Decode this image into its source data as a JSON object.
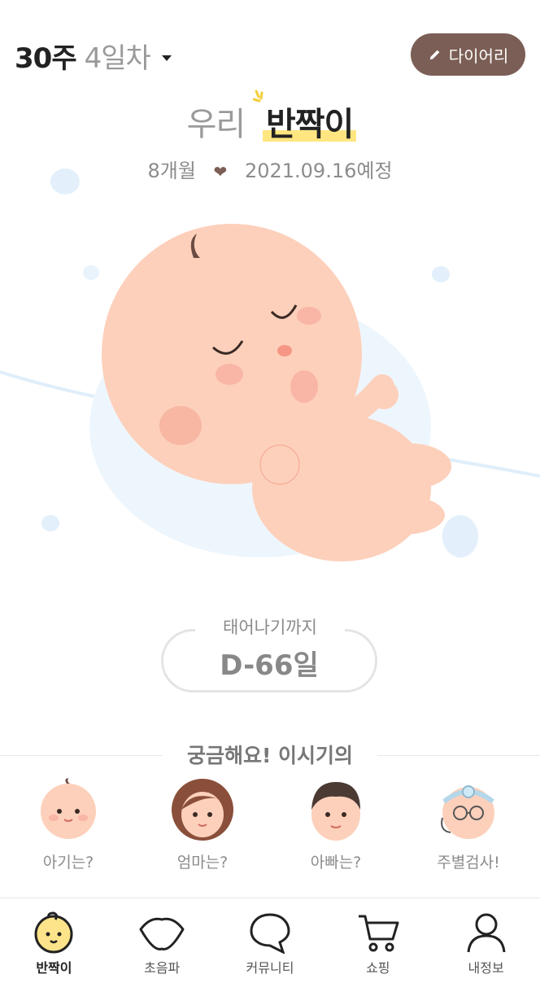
{
  "header": {
    "week": "30주",
    "day": "4일차",
    "diary_label": "다이어리"
  },
  "title": {
    "prefix": "우리",
    "name": "반짝이"
  },
  "subtitle": {
    "months": "8개월",
    "heart": "❤",
    "due": "2021.09.16예정"
  },
  "countdown": {
    "label": "태어나기까지",
    "value": "D-66일"
  },
  "curious": {
    "title": "궁금해요! 이시기의",
    "items": [
      {
        "label": "아기는?"
      },
      {
        "label": "엄마는?"
      },
      {
        "label": "아빠는?"
      },
      {
        "label": "주별검사!"
      }
    ]
  },
  "nav": {
    "items": [
      {
        "label": "반짝이",
        "icon": "baby-face-icon"
      },
      {
        "label": "초음파",
        "icon": "ultrasound-icon"
      },
      {
        "label": "커뮤니티",
        "icon": "chat-bubble-icon"
      },
      {
        "label": "쇼핑",
        "icon": "cart-icon"
      },
      {
        "label": "내정보",
        "icon": "person-icon"
      }
    ],
    "active_index": 0
  },
  "colors": {
    "brand_brown": "#7b5e55",
    "highlight_yellow": "#ffe680",
    "skin": "#fdd0bb"
  }
}
